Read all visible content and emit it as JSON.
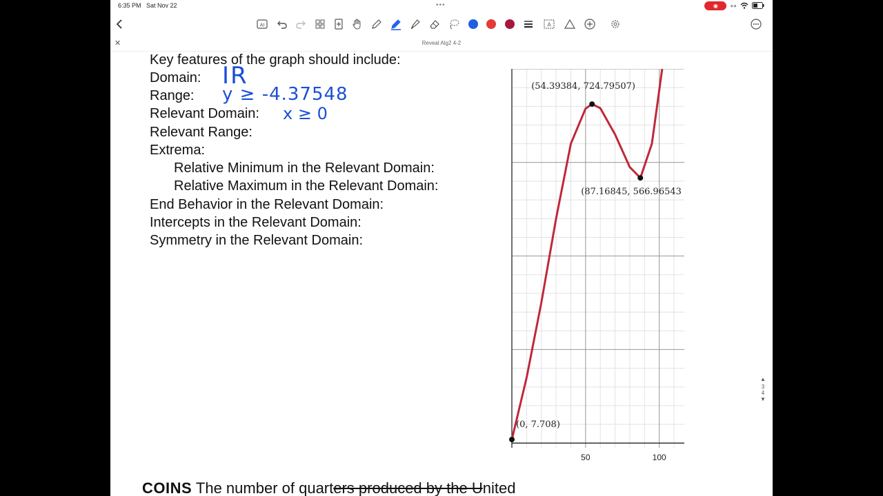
{
  "status": {
    "time": "6:35 PM",
    "date": "Sat Nov 22"
  },
  "document": {
    "title": "Reveal Alg2 4-2"
  },
  "toolbar": {
    "tools": [
      "back-icon",
      "ai-icon",
      "undo-icon",
      "redo-icon",
      "grid-icon",
      "add-page-icon",
      "hand-icon",
      "pencil-icon",
      "pen-icon",
      "highlighter-icon",
      "eraser-icon",
      "lasso-icon",
      "color-blue",
      "color-red",
      "color-crimson",
      "stroke-width-icon",
      "text-box-icon",
      "shape-icon",
      "add-icon",
      "settings-icon",
      "more-icon"
    ],
    "colors": {
      "blue": "#1f5fe0",
      "red": "#e23b35",
      "crimson": "#a6193c"
    }
  },
  "worksheet": {
    "heading": "Key features of the graph should include:",
    "domain_label": "Domain:",
    "range_label": "Range:",
    "relevant_domain_label": "Relevant Domain:",
    "relevant_range_label": "Relevant Range:",
    "extrema_label": "Extrema:",
    "rel_min_label": "Relative Minimum in the Relevant Domain:",
    "rel_max_label": "Relative Maximum in the Relevant Domain:",
    "end_behavior_label": "End Behavior in the Relevant Domain:",
    "intercepts_label": "Intercepts in the Relevant Domain:",
    "symmetry_label": "Symmetry in the Relevant Domain:"
  },
  "handwriting": {
    "domain": "IR",
    "range": "y ≥ -4.37548",
    "relevant_domain": "x ≥ 0"
  },
  "graph": {
    "point_labels": [
      "(54.39384, 724.79507)",
      "(87.16845, 566.96543",
      "(0, 7.708)"
    ],
    "x_ticks": [
      "50",
      "100"
    ],
    "curve_color": "#c0273a"
  },
  "chart_data": {
    "type": "line",
    "title": "",
    "xlabel": "",
    "ylabel": "",
    "x_ticks": [
      50,
      100
    ],
    "xlim": [
      0,
      117
    ],
    "ylim": [
      -10,
      800
    ],
    "grid": true,
    "series": [
      {
        "values_x": [
          0,
          10,
          20,
          30,
          40,
          50,
          54.39,
          60,
          70,
          80,
          87.17,
          95,
          102
        ],
        "values_y": [
          7.708,
          140,
          300,
          480,
          640,
          715,
          724.8,
          716,
          660,
          590,
          567,
          640,
          800
        ]
      }
    ],
    "points": [
      {
        "x": 54.39384,
        "y": 724.79507
      },
      {
        "x": 87.16845,
        "y": 566.96543
      },
      {
        "x": 0,
        "y": 7.708
      }
    ]
  },
  "bottom_problem": {
    "bold": "COINS",
    "text_a": "The number of quart",
    "text_b": "ers produced by the U",
    "text_c": "nited"
  },
  "pager": {
    "current": "3",
    "next": "4"
  }
}
